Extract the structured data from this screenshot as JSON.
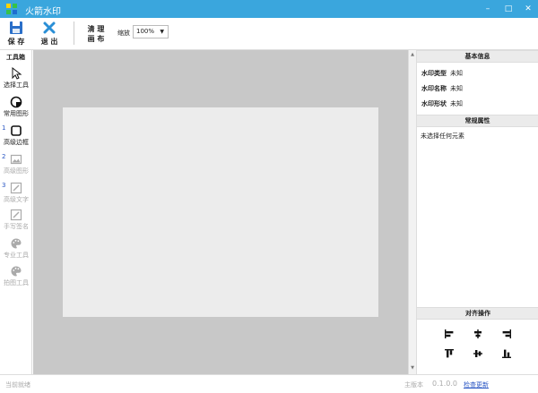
{
  "window": {
    "title": "火箭水印",
    "controls": [
      "–",
      "□",
      "✕"
    ]
  },
  "toolbar": {
    "save_label": "保 存",
    "exit_label": "退 出",
    "clear_line1": "清 理",
    "clear_line2": "画 布",
    "zoom_label": "缩放",
    "zoom_value": "100%"
  },
  "toolbox": {
    "header": "工具箱",
    "tools": [
      {
        "label": "选择工具"
      },
      {
        "label": "常用图形"
      },
      {
        "label": "高级边框",
        "num": "1"
      },
      {
        "label": "高级图形",
        "num": "2"
      },
      {
        "label": "高级文字",
        "num": "3"
      },
      {
        "label": "手写签名"
      },
      {
        "label": "专业工具"
      },
      {
        "label": "拍图工具"
      }
    ]
  },
  "right": {
    "basic_header": "基本信息",
    "rows": [
      {
        "key": "水印类型",
        "value": "未知"
      },
      {
        "key": "水印名称",
        "value": "未知"
      },
      {
        "key": "水印形状",
        "value": "未知"
      }
    ],
    "props_header": "常规属性",
    "props_empty": "未选择任何元素",
    "align_header": "对齐操作"
  },
  "statusbar": {
    "status": "当前就绪",
    "version_label": "主版本",
    "version": "0.1.0.0",
    "update": "检查更新"
  },
  "colors": {
    "titlebar": "#3aa6dd",
    "canvas_bg": "#c8c8c8",
    "artboard": "#ececec",
    "link": "#2b57c4"
  }
}
